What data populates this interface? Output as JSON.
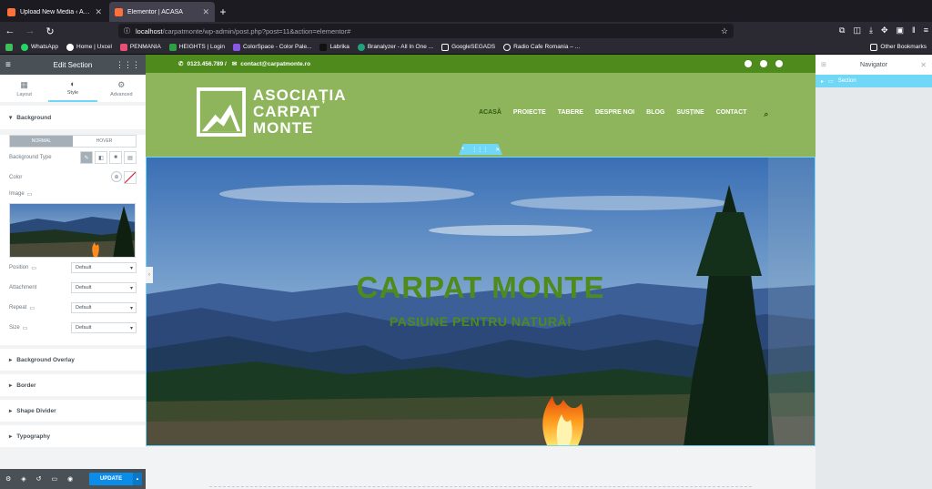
{
  "browser": {
    "tabs": [
      {
        "title": "Upload New Media ‹ Asociația",
        "active": false
      },
      {
        "title": "Elementor | ACASĂ",
        "active": true
      }
    ],
    "url_host": "localhost",
    "url_path": "/carpatmonte/wp-admin/post.php?post=11&action=elementor#",
    "bookmarks": [
      "WhatsApp",
      "Home | Uxcel",
      "PENMANIA",
      "HEIGHTS | Login",
      "ColorSpace - Color Pale...",
      "Labrika",
      "Branalyzer - All In One ...",
      "GoogleSEGADS",
      "Radio Cafe Romania – ..."
    ],
    "other_bookmarks": "Other Bookmarks"
  },
  "panel": {
    "title": "Edit Section",
    "tabs": [
      "Layout",
      "Style",
      "Advanced"
    ],
    "background": {
      "heading": "Background",
      "states": [
        "NORMAL",
        "HOVER"
      ],
      "type_label": "Background Type",
      "color_label": "Color",
      "image_label": "Image",
      "position_label": "Position",
      "attachment_label": "Attachment",
      "repeat_label": "Repeat",
      "size_label": "Size",
      "position_value": "Default",
      "attachment_value": "Default",
      "repeat_value": "Default",
      "size_value": "Default"
    },
    "collapsed_sections": [
      "Background Overlay",
      "Border",
      "Shape Divider",
      "Typography"
    ],
    "update_label": "UPDATE"
  },
  "site": {
    "phone": "0123.456.789 /",
    "email": "contact@carpatmonte.ro",
    "logo_lines": [
      "ASOCIAȚIA",
      "CARPAT",
      "MONTE"
    ],
    "menu": [
      "ACASĂ",
      "PROIECTE",
      "TABERE",
      "DESPRE NOI",
      "BLOG",
      "SUSȚINE",
      "CONTACT"
    ],
    "hero_title": "CARPAT MONTE",
    "hero_subtitle": "PASIUNE PENTRU NATURĂ!"
  },
  "navigator": {
    "title": "Navigator",
    "item": "Section"
  },
  "colors": {
    "green_dark": "#4f8a1c",
    "green_light": "#8fb55c",
    "elementor_blue": "#71d7f7",
    "update_blue": "#0c8ce9"
  }
}
